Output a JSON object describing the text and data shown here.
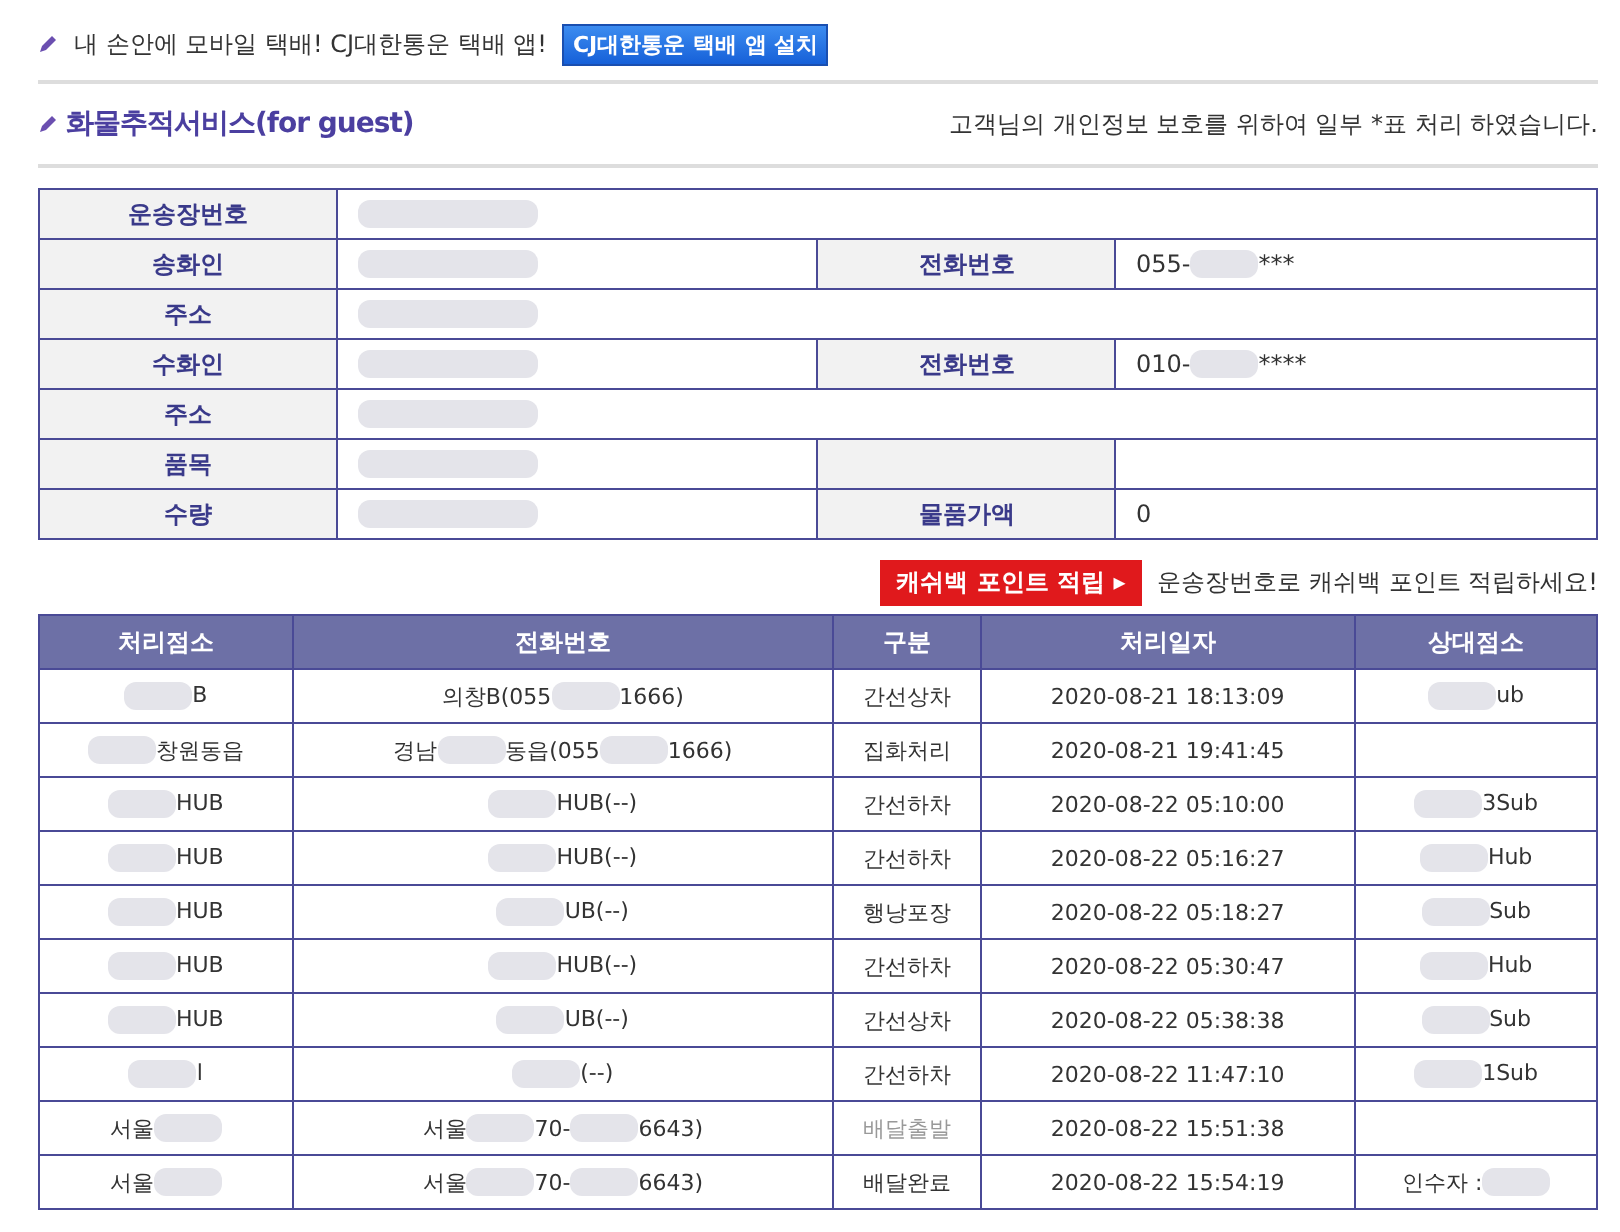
{
  "promo": {
    "text": "내 손안에 모바일 택배! CJ대한통운 택배 앱!",
    "button": "CJ대한통운 택배 앱 설치"
  },
  "header": {
    "title": "화물추적서비스(for guest)",
    "notice": "고객님의 개인정보 보호를 위하여 일부 *표 처리 하였습니다."
  },
  "info": [
    {
      "cells": [
        {
          "label": "운송장번호",
          "segments": [
            {
              "kind": "redacted"
            }
          ]
        }
      ]
    },
    {
      "cells": [
        {
          "label": "송화인",
          "segments": [
            {
              "kind": "redacted"
            }
          ]
        },
        {
          "label": "전화번호",
          "segments": [
            {
              "kind": "text",
              "text": "055-"
            },
            {
              "kind": "redacted"
            },
            {
              "kind": "text",
              "text": "***"
            }
          ]
        }
      ]
    },
    {
      "cells": [
        {
          "label": "주소",
          "segments": [
            {
              "kind": "redacted"
            }
          ]
        }
      ]
    },
    {
      "cells": [
        {
          "label": "수화인",
          "segments": [
            {
              "kind": "redacted"
            }
          ]
        },
        {
          "label": "전화번호",
          "segments": [
            {
              "kind": "text",
              "text": "010-"
            },
            {
              "kind": "redacted"
            },
            {
              "kind": "text",
              "text": "****"
            }
          ]
        }
      ]
    },
    {
      "cells": [
        {
          "label": "주소",
          "segments": [
            {
              "kind": "redacted"
            }
          ]
        }
      ]
    },
    {
      "cells": [
        {
          "label": "품목",
          "segments": [
            {
              "kind": "redacted"
            }
          ]
        },
        {}
      ]
    },
    {
      "cells": [
        {
          "label": "수량",
          "segments": [
            {
              "kind": "redacted"
            }
          ]
        },
        {
          "label": "물품가액",
          "segments": [
            {
              "kind": "text",
              "text": "0"
            }
          ]
        }
      ]
    }
  ],
  "cashback": {
    "button": "캐쉬백 포인트 적립 ▸",
    "text": "운송장번호로 캐쉬백 포인트 적립하세요!"
  },
  "table": {
    "columns": [
      "처리점소",
      "전화번호",
      "구분",
      "처리일자",
      "상대점소"
    ],
    "rows": [
      {
        "muted": false,
        "cells": [
          [
            {
              "kind": "redacted"
            },
            {
              "kind": "text",
              "text": "B"
            }
          ],
          [
            {
              "kind": "text",
              "text": "의창B(055"
            },
            {
              "kind": "redacted"
            },
            {
              "kind": "text",
              "text": "1666)"
            }
          ],
          [
            {
              "kind": "text",
              "text": "간선상차"
            }
          ],
          [
            {
              "kind": "text",
              "text": "2020-08-21 18:13:09"
            }
          ],
          [
            {
              "kind": "redacted"
            },
            {
              "kind": "text",
              "text": "ub"
            }
          ]
        ]
      },
      {
        "muted": false,
        "cells": [
          [
            {
              "kind": "redacted"
            },
            {
              "kind": "text",
              "text": "창원동읍"
            }
          ],
          [
            {
              "kind": "text",
              "text": "경남"
            },
            {
              "kind": "redacted"
            },
            {
              "kind": "text",
              "text": "동읍(055"
            },
            {
              "kind": "redacted"
            },
            {
              "kind": "text",
              "text": "1666)"
            }
          ],
          [
            {
              "kind": "text",
              "text": "집화처리"
            }
          ],
          [
            {
              "kind": "text",
              "text": "2020-08-21 19:41:45"
            }
          ],
          []
        ]
      },
      {
        "muted": false,
        "cells": [
          [
            {
              "kind": "redacted"
            },
            {
              "kind": "text",
              "text": "HUB"
            }
          ],
          [
            {
              "kind": "redacted"
            },
            {
              "kind": "text",
              "text": "HUB(--)"
            }
          ],
          [
            {
              "kind": "text",
              "text": "간선하차"
            }
          ],
          [
            {
              "kind": "text",
              "text": "2020-08-22 05:10:00"
            }
          ],
          [
            {
              "kind": "redacted"
            },
            {
              "kind": "text",
              "text": "3Sub"
            }
          ]
        ]
      },
      {
        "muted": false,
        "cells": [
          [
            {
              "kind": "redacted"
            },
            {
              "kind": "text",
              "text": "HUB"
            }
          ],
          [
            {
              "kind": "redacted"
            },
            {
              "kind": "text",
              "text": "HUB(--)"
            }
          ],
          [
            {
              "kind": "text",
              "text": "간선하차"
            }
          ],
          [
            {
              "kind": "text",
              "text": "2020-08-22 05:16:27"
            }
          ],
          [
            {
              "kind": "redacted"
            },
            {
              "kind": "text",
              "text": "Hub"
            }
          ]
        ]
      },
      {
        "muted": false,
        "cells": [
          [
            {
              "kind": "redacted"
            },
            {
              "kind": "text",
              "text": "HUB"
            }
          ],
          [
            {
              "kind": "redacted"
            },
            {
              "kind": "text",
              "text": "UB(--)"
            }
          ],
          [
            {
              "kind": "text",
              "text": "행낭포장"
            }
          ],
          [
            {
              "kind": "text",
              "text": "2020-08-22 05:18:27"
            }
          ],
          [
            {
              "kind": "redacted"
            },
            {
              "kind": "text",
              "text": "Sub"
            }
          ]
        ]
      },
      {
        "muted": false,
        "cells": [
          [
            {
              "kind": "redacted"
            },
            {
              "kind": "text",
              "text": "HUB"
            }
          ],
          [
            {
              "kind": "redacted"
            },
            {
              "kind": "text",
              "text": "HUB(--)"
            }
          ],
          [
            {
              "kind": "text",
              "text": "간선하차"
            }
          ],
          [
            {
              "kind": "text",
              "text": "2020-08-22 05:30:47"
            }
          ],
          [
            {
              "kind": "redacted"
            },
            {
              "kind": "text",
              "text": "Hub"
            }
          ]
        ]
      },
      {
        "muted": false,
        "cells": [
          [
            {
              "kind": "redacted"
            },
            {
              "kind": "text",
              "text": "HUB"
            }
          ],
          [
            {
              "kind": "redacted"
            },
            {
              "kind": "text",
              "text": "UB(--)"
            }
          ],
          [
            {
              "kind": "text",
              "text": "간선상차"
            }
          ],
          [
            {
              "kind": "text",
              "text": "2020-08-22 05:38:38"
            }
          ],
          [
            {
              "kind": "redacted"
            },
            {
              "kind": "text",
              "text": "Sub"
            }
          ]
        ]
      },
      {
        "muted": false,
        "cells": [
          [
            {
              "kind": "redacted"
            },
            {
              "kind": "text",
              "text": "l"
            }
          ],
          [
            {
              "kind": "redacted"
            },
            {
              "kind": "text",
              "text": "(--)"
            }
          ],
          [
            {
              "kind": "text",
              "text": "간선하차"
            }
          ],
          [
            {
              "kind": "text",
              "text": "2020-08-22 11:47:10"
            }
          ],
          [
            {
              "kind": "redacted"
            },
            {
              "kind": "text",
              "text": "1Sub"
            }
          ]
        ]
      },
      {
        "muted": true,
        "cells": [
          [
            {
              "kind": "text",
              "text": "서울"
            },
            {
              "kind": "redacted"
            }
          ],
          [
            {
              "kind": "text",
              "text": "서울"
            },
            {
              "kind": "redacted"
            },
            {
              "kind": "text",
              "text": "70-"
            },
            {
              "kind": "redacted"
            },
            {
              "kind": "text",
              "text": "6643)"
            }
          ],
          [
            {
              "kind": "text",
              "text": "배달출발"
            }
          ],
          [
            {
              "kind": "text",
              "text": "2020-08-22 15:51:38"
            }
          ],
          []
        ]
      },
      {
        "muted": false,
        "cells": [
          [
            {
              "kind": "text",
              "text": "서울"
            },
            {
              "kind": "redacted"
            }
          ],
          [
            {
              "kind": "text",
              "text": "서울"
            },
            {
              "kind": "redacted"
            },
            {
              "kind": "text",
              "text": "70-"
            },
            {
              "kind": "redacted"
            },
            {
              "kind": "text",
              "text": "6643)"
            }
          ],
          [
            {
              "kind": "text",
              "text": "배달완료"
            }
          ],
          [
            {
              "kind": "text",
              "text": "2020-08-22 15:54:19"
            }
          ],
          [
            {
              "kind": "text",
              "text": "인수자 :"
            },
            {
              "kind": "redacted"
            }
          ]
        ]
      }
    ]
  }
}
